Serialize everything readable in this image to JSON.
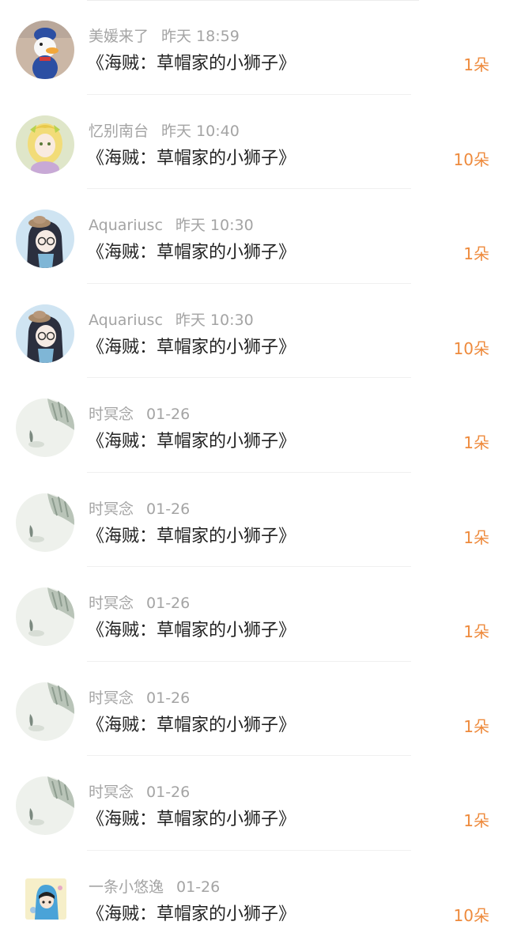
{
  "list": {
    "items": [
      {
        "user": "美媛来了",
        "time": "昨天 18:59",
        "title": "《海贼：草帽家的小狮子》",
        "count": "1朵",
        "avatar": "donald-duck-avatar"
      },
      {
        "user": "忆别南台",
        "time": "昨天 10:40",
        "title": "《海贼：草帽家的小狮子》",
        "count": "10朵",
        "avatar": "anime-girl-yellow-avatar"
      },
      {
        "user": "Aquariusc",
        "time": "昨天 10:30",
        "title": "《海贼：草帽家的小狮子》",
        "count": "1朵",
        "avatar": "glasses-girl-avatar"
      },
      {
        "user": "Aquariusc",
        "time": "昨天 10:30",
        "title": "《海贼：草帽家的小狮子》",
        "count": "10朵",
        "avatar": "glasses-girl-avatar"
      },
      {
        "user": "时冥念",
        "time": "01-26",
        "title": "《海贼：草帽家的小狮子》",
        "count": "1朵",
        "avatar": "ink-wash-avatar"
      },
      {
        "user": "时冥念",
        "time": "01-26",
        "title": "《海贼：草帽家的小狮子》",
        "count": "1朵",
        "avatar": "ink-wash-avatar"
      },
      {
        "user": "时冥念",
        "time": "01-26",
        "title": "《海贼：草帽家的小狮子》",
        "count": "1朵",
        "avatar": "ink-wash-avatar"
      },
      {
        "user": "时冥念",
        "time": "01-26",
        "title": "《海贼：草帽家的小狮子》",
        "count": "1朵",
        "avatar": "ink-wash-avatar"
      },
      {
        "user": "时冥念",
        "time": "01-26",
        "title": "《海贼：草帽家的小狮子》",
        "count": "1朵",
        "avatar": "ink-wash-avatar"
      },
      {
        "user": "一条小悠逸",
        "time": "01-26",
        "title": "《海贼：草帽家的小狮子》",
        "count": "10朵",
        "avatar": "cartoon-boy-avatar"
      }
    ]
  },
  "colors": {
    "accent": "#ee8a3c",
    "meta_text": "#a4a4a4",
    "title_text": "#222222"
  }
}
